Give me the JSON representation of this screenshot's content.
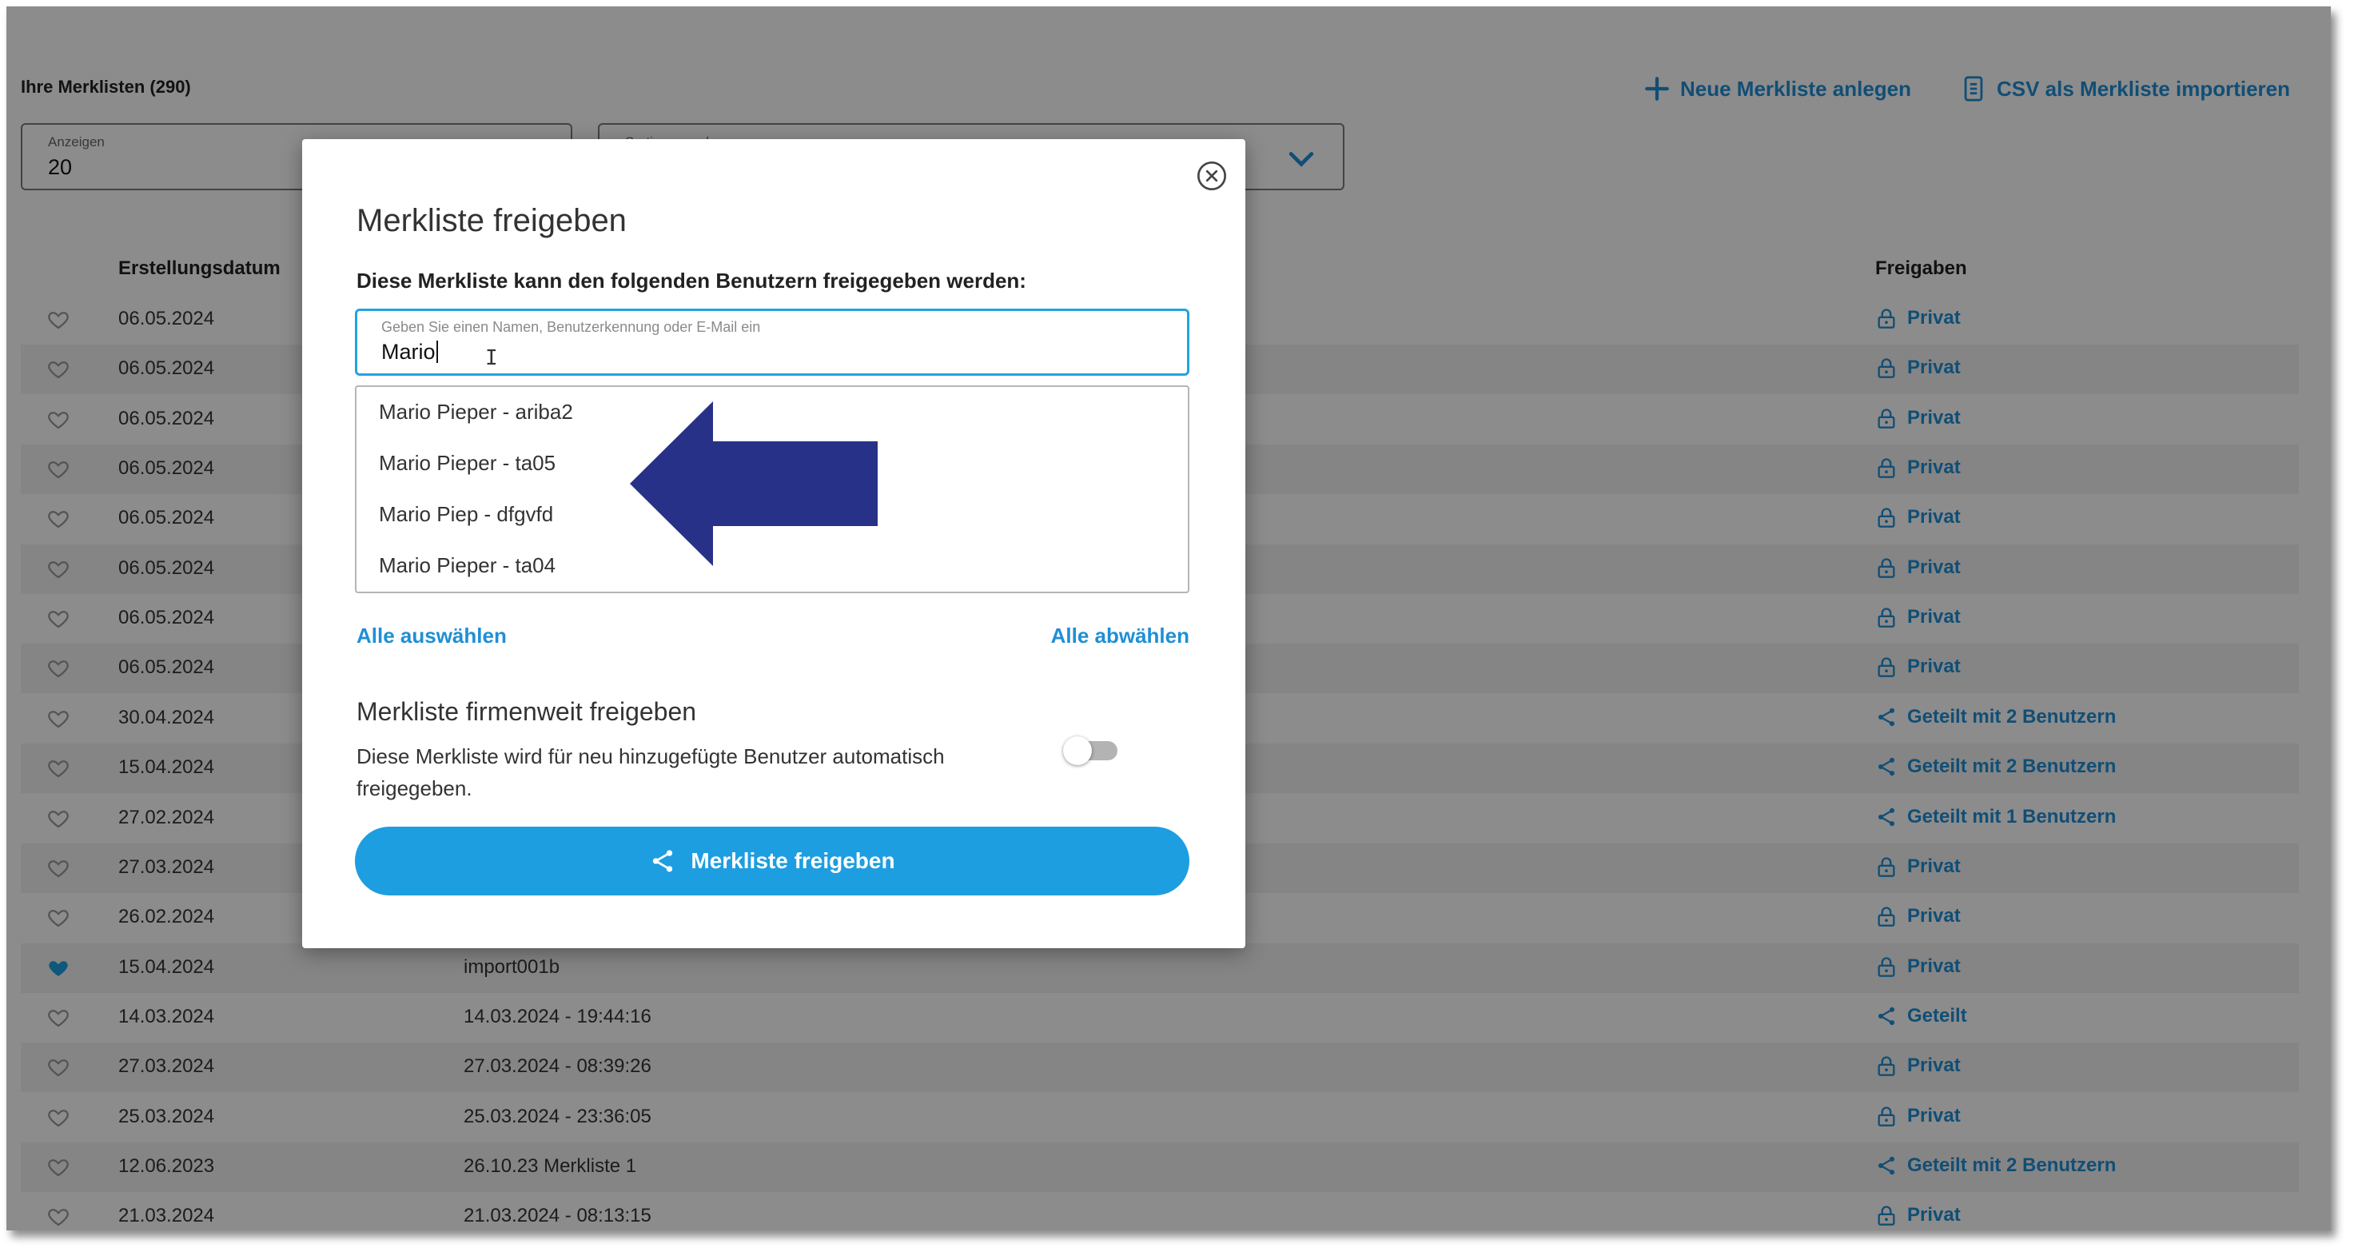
{
  "header": {
    "title": "Ihre Merklisten (290)",
    "new_list_label": "Neue Merkliste anlegen",
    "import_csv_label": "CSV als Merkliste importieren"
  },
  "filters": {
    "show_label": "Anzeigen",
    "show_value": "20",
    "sort_label": "Sortieren nach"
  },
  "table": {
    "col_date": "Erstellungsdatum",
    "col_shares": "Freigaben",
    "rows": [
      {
        "date": "06.05.2024",
        "name": "",
        "share": "Privat",
        "share_icon": "lock-icon",
        "favorite": false
      },
      {
        "date": "06.05.2024",
        "name": "",
        "share": "Privat",
        "share_icon": "lock-icon",
        "favorite": false
      },
      {
        "date": "06.05.2024",
        "name": "",
        "share": "Privat",
        "share_icon": "lock-icon",
        "favorite": false
      },
      {
        "date": "06.05.2024",
        "name": "",
        "share": "Privat",
        "share_icon": "lock-icon",
        "favorite": false
      },
      {
        "date": "06.05.2024",
        "name": "",
        "share": "Privat",
        "share_icon": "lock-icon",
        "favorite": false
      },
      {
        "date": "06.05.2024",
        "name": "",
        "share": "Privat",
        "share_icon": "lock-icon",
        "favorite": false
      },
      {
        "date": "06.05.2024",
        "name": "",
        "share": "Privat",
        "share_icon": "lock-icon",
        "favorite": false
      },
      {
        "date": "06.05.2024",
        "name": "",
        "share": "Privat",
        "share_icon": "lock-icon",
        "favorite": false
      },
      {
        "date": "30.04.2024",
        "name": "",
        "share": "Geteilt mit 2 Benutzern",
        "share_icon": "share-icon",
        "favorite": false
      },
      {
        "date": "15.04.2024",
        "name": "",
        "share": "Geteilt mit 2 Benutzern",
        "share_icon": "share-icon",
        "favorite": false
      },
      {
        "date": "27.02.2024",
        "name": "",
        "share": "Geteilt mit 1 Benutzern",
        "share_icon": "share-icon",
        "favorite": false
      },
      {
        "date": "27.03.2024",
        "name": "",
        "share": "Privat",
        "share_icon": "lock-icon",
        "favorite": false
      },
      {
        "date": "26.02.2024",
        "name": "",
        "share": "Privat",
        "share_icon": "lock-icon",
        "favorite": false
      },
      {
        "date": "15.04.2024",
        "name": "import001b",
        "share": "Privat",
        "share_icon": "lock-icon",
        "favorite": true
      },
      {
        "date": "14.03.2024",
        "name": "14.03.2024 - 19:44:16",
        "share": "Geteilt",
        "share_icon": "share-icon",
        "favorite": false
      },
      {
        "date": "27.03.2024",
        "name": "27.03.2024 - 08:39:26",
        "share": "Privat",
        "share_icon": "lock-icon",
        "favorite": false
      },
      {
        "date": "25.03.2024",
        "name": "25.03.2024 - 23:36:05",
        "share": "Privat",
        "share_icon": "lock-icon",
        "favorite": false
      },
      {
        "date": "12.06.2023",
        "name": "26.10.23 Merkliste 1",
        "share": "Geteilt mit 2 Benutzern",
        "share_icon": "share-icon",
        "favorite": false
      },
      {
        "date": "21.03.2024",
        "name": "21.03.2024 - 08:13:15",
        "share": "Privat",
        "share_icon": "lock-icon",
        "favorite": false
      }
    ]
  },
  "dialog": {
    "title": "Merkliste freigeben",
    "subtitle": "Diese Merkliste kann den folgenden Benutzern freigegeben werden:",
    "search_placeholder": "Geben Sie einen Namen, Benutzerkennung oder E-Mail ein",
    "search_value": "Mario",
    "suggestions": [
      "Mario Pieper - ariba2",
      "Mario Pieper - ta05",
      "Mario Piep - dfgvfd",
      "Mario Pieper - ta04"
    ],
    "select_all": "Alle auswählen",
    "deselect_all": "Alle abwählen",
    "company_title": "Merkliste firmenweit freigeben",
    "company_desc": "Diese Merkliste wird für neu hinzugefügte Benutzer automatisch freigegeben.",
    "company_toggle_on": false,
    "submit_label": "Merkliste freigeben"
  },
  "colors": {
    "accent": "#1f8fd6",
    "button": "#1d9ee0",
    "input_focus": "#22a3e0",
    "annotation_arrow": "#283188",
    "favorite": "#1d9ee0"
  }
}
